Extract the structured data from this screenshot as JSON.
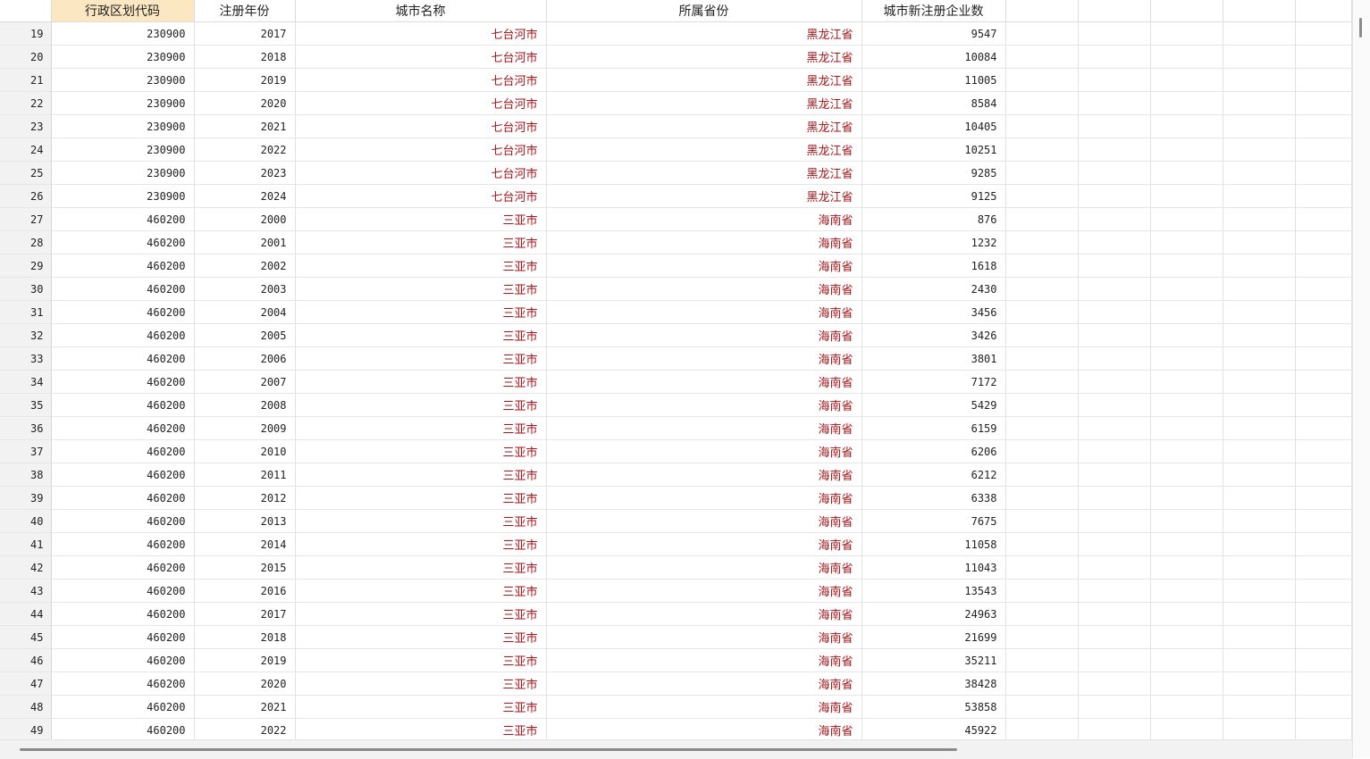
{
  "columns": [
    "行政区划代码",
    "注册年份",
    "城市名称",
    "所属省份",
    "城市新注册企业数"
  ],
  "rows": [
    [
      "19",
      "230900",
      "2017",
      "七台河市",
      "黑龙江省",
      "9547"
    ],
    [
      "20",
      "230900",
      "2018",
      "七台河市",
      "黑龙江省",
      "10084"
    ],
    [
      "21",
      "230900",
      "2019",
      "七台河市",
      "黑龙江省",
      "11005"
    ],
    [
      "22",
      "230900",
      "2020",
      "七台河市",
      "黑龙江省",
      "8584"
    ],
    [
      "23",
      "230900",
      "2021",
      "七台河市",
      "黑龙江省",
      "10405"
    ],
    [
      "24",
      "230900",
      "2022",
      "七台河市",
      "黑龙江省",
      "10251"
    ],
    [
      "25",
      "230900",
      "2023",
      "七台河市",
      "黑龙江省",
      "9285"
    ],
    [
      "26",
      "230900",
      "2024",
      "七台河市",
      "黑龙江省",
      "9125"
    ],
    [
      "27",
      "460200",
      "2000",
      "三亚市",
      "海南省",
      "876"
    ],
    [
      "28",
      "460200",
      "2001",
      "三亚市",
      "海南省",
      "1232"
    ],
    [
      "29",
      "460200",
      "2002",
      "三亚市",
      "海南省",
      "1618"
    ],
    [
      "30",
      "460200",
      "2003",
      "三亚市",
      "海南省",
      "2430"
    ],
    [
      "31",
      "460200",
      "2004",
      "三亚市",
      "海南省",
      "3456"
    ],
    [
      "32",
      "460200",
      "2005",
      "三亚市",
      "海南省",
      "3426"
    ],
    [
      "33",
      "460200",
      "2006",
      "三亚市",
      "海南省",
      "3801"
    ],
    [
      "34",
      "460200",
      "2007",
      "三亚市",
      "海南省",
      "7172"
    ],
    [
      "35",
      "460200",
      "2008",
      "三亚市",
      "海南省",
      "5429"
    ],
    [
      "36",
      "460200",
      "2009",
      "三亚市",
      "海南省",
      "6159"
    ],
    [
      "37",
      "460200",
      "2010",
      "三亚市",
      "海南省",
      "6206"
    ],
    [
      "38",
      "460200",
      "2011",
      "三亚市",
      "海南省",
      "6212"
    ],
    [
      "39",
      "460200",
      "2012",
      "三亚市",
      "海南省",
      "6338"
    ],
    [
      "40",
      "460200",
      "2013",
      "三亚市",
      "海南省",
      "7675"
    ],
    [
      "41",
      "460200",
      "2014",
      "三亚市",
      "海南省",
      "11058"
    ],
    [
      "42",
      "460200",
      "2015",
      "三亚市",
      "海南省",
      "11043"
    ],
    [
      "43",
      "460200",
      "2016",
      "三亚市",
      "海南省",
      "13543"
    ],
    [
      "44",
      "460200",
      "2017",
      "三亚市",
      "海南省",
      "24963"
    ],
    [
      "45",
      "460200",
      "2018",
      "三亚市",
      "海南省",
      "21699"
    ],
    [
      "46",
      "460200",
      "2019",
      "三亚市",
      "海南省",
      "35211"
    ],
    [
      "47",
      "460200",
      "2020",
      "三亚市",
      "海南省",
      "38428"
    ],
    [
      "48",
      "460200",
      "2021",
      "三亚市",
      "海南省",
      "53858"
    ],
    [
      "49",
      "460200",
      "2022",
      "三亚市",
      "海南省",
      "45922"
    ]
  ],
  "colors": {
    "string_text": "#a4161a",
    "selected_header": "#fbe7c2",
    "row_number_bg": "#f2f2f2"
  },
  "selected_column": "行政区划代码"
}
